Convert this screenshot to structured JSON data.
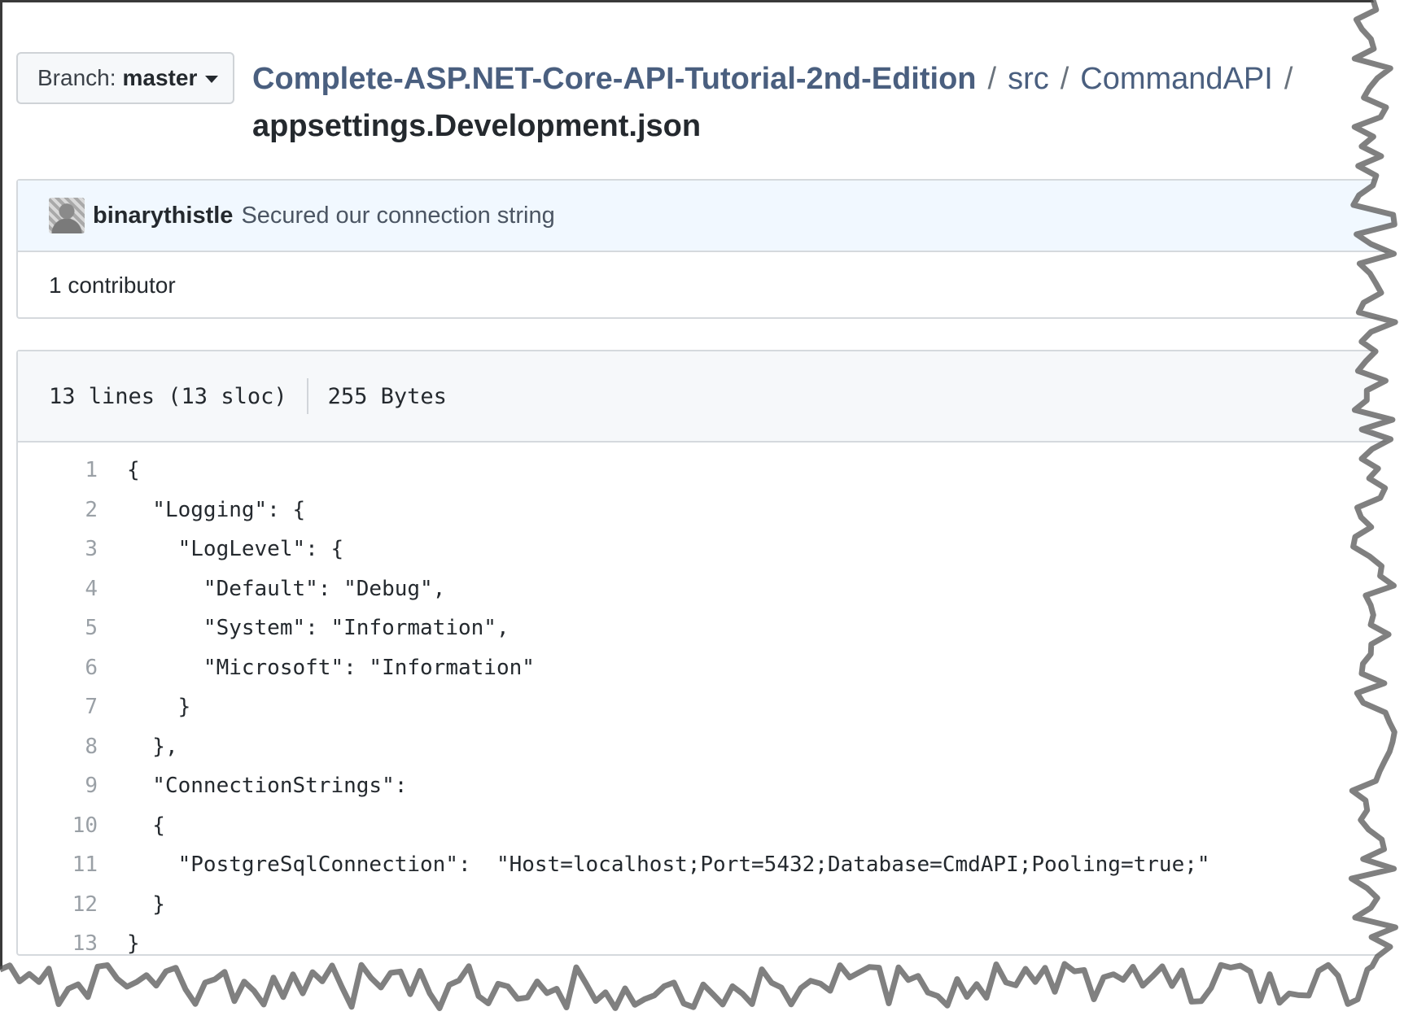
{
  "branch": {
    "prefix": "Branch:",
    "name": "master"
  },
  "breadcrumb": {
    "repo": "Complete-ASP.NET-Core-API-Tutorial-2nd-Edition",
    "sep1": "/",
    "folder1": "src",
    "sep2": "/",
    "folder2": "CommandAPI",
    "sep3": "/",
    "file": "appsettings.Development.json"
  },
  "commit": {
    "author": "binarythistle",
    "message": "Secured our connection string",
    "contributors": "1 contributor"
  },
  "file_info": {
    "lines": "13 lines (13 sloc)",
    "size": "255 Bytes"
  },
  "code": [
    {
      "n": "1",
      "text": "{"
    },
    {
      "n": "2",
      "text": "  \"Logging\": {"
    },
    {
      "n": "3",
      "text": "    \"LogLevel\": {"
    },
    {
      "n": "4",
      "text": "      \"Default\": \"Debug\","
    },
    {
      "n": "5",
      "text": "      \"System\": \"Information\","
    },
    {
      "n": "6",
      "text": "      \"Microsoft\": \"Information\""
    },
    {
      "n": "7",
      "text": "    }"
    },
    {
      "n": "8",
      "text": "  },"
    },
    {
      "n": "9",
      "text": "  \"ConnectionStrings\":"
    },
    {
      "n": "10",
      "text": "  {"
    },
    {
      "n": "11",
      "text": "    \"PostgreSqlConnection\":  \"Host=localhost;Port=5432;Database=CmdAPI;Pooling=true;\""
    },
    {
      "n": "12",
      "text": "  }"
    },
    {
      "n": "13",
      "text": "}"
    }
  ],
  "colors": {
    "link": "#4a5f7f",
    "commit_bg": "#f1f8ff",
    "header_bg": "#f6f8fa",
    "border": "#d5d9dd"
  }
}
